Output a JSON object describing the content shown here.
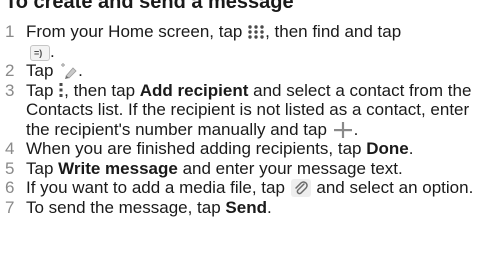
{
  "heading": "To create and send a message",
  "steps": [
    {
      "number": "1",
      "parts": [
        "From your Home screen, tap ",
        ", then find and tap",
        "."
      ]
    },
    {
      "number": "2",
      "parts": [
        "Tap ",
        "."
      ]
    },
    {
      "number": "3",
      "parts": [
        "Tap ",
        ", then tap ",
        "Add recipient",
        " and select a contact from the Contacts list. If the recipient is not listed as a contact, enter the recipient's number manually and tap ",
        "."
      ]
    },
    {
      "number": "4",
      "parts": [
        "When you are finished adding recipients, tap ",
        "Done",
        "."
      ]
    },
    {
      "number": "5",
      "parts": [
        "Tap ",
        "Write message",
        " and enter your message text."
      ]
    },
    {
      "number": "6",
      "parts": [
        "If you want to add a media file, tap ",
        " and select an option."
      ]
    },
    {
      "number": "7",
      "parts": [
        "To send the message, tap ",
        "Send",
        "."
      ]
    }
  ],
  "icons": {
    "apps": "apps-grid-icon",
    "messaging": "messaging-app-icon",
    "compose": "compose-new-message-icon",
    "menu": "menu-dots-icon",
    "add": "plus-icon",
    "attach": "paperclip-attach-icon"
  },
  "colors": {
    "text": "#1a1a1a",
    "step_number": "#8a8a8a",
    "apps_icon": "#4a4a4a",
    "icon_accent": "#5a9ad6"
  }
}
